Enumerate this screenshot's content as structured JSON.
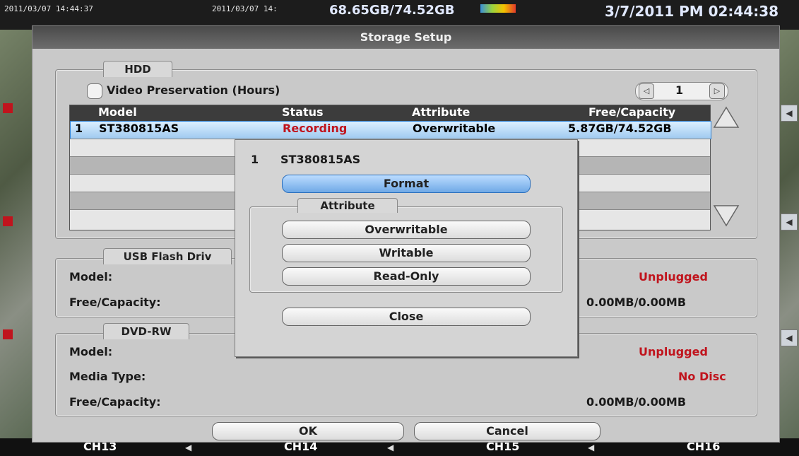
{
  "top": {
    "timestamp_left": "2011/03/07 14:44:37",
    "timestamp_mid": "2011/03/07 14:",
    "storage_usage": "68.65GB/74.52GB",
    "datetime": "3/7/2011 PM 02:44:38"
  },
  "dialog": {
    "title": "Storage Setup",
    "hdd": {
      "tab": "HDD",
      "video_preservation": "Video Preservation (Hours)",
      "page": "1",
      "columns": [
        "Model",
        "Status",
        "Attribute",
        "Free/Capacity"
      ],
      "rows": [
        {
          "index": "1",
          "model": "ST380815AS",
          "status": "Recording",
          "attribute": "Overwritable",
          "capacity": "5.87GB/74.52GB"
        }
      ]
    },
    "usb": {
      "tab": "USB Flash Driv",
      "model_label": "Model:",
      "model_value": "Unplugged",
      "capacity_label": "Free/Capacity:",
      "capacity_value": "0.00MB/0.00MB"
    },
    "dvd": {
      "tab": "DVD-RW",
      "model_label": "Model:",
      "model_value": "Unplugged",
      "media_label": "Media Type:",
      "media_value": "No Disc",
      "capacity_label": "Free/Capacity:",
      "capacity_value": "0.00MB/0.00MB"
    },
    "ok": "OK",
    "cancel": "Cancel"
  },
  "popup": {
    "index": "1",
    "model": "ST380815AS",
    "format": "Format",
    "attribute_tab": "Attribute",
    "overwritable": "Overwritable",
    "writable": "Writable",
    "read_only": "Read-Only",
    "close": "Close"
  },
  "channels": [
    "CH13",
    "CH14",
    "CH15",
    "CH16"
  ],
  "colors": {
    "status_red": "#c0141d",
    "selected_row": "#9fcaf0",
    "title_bar": "#4a4a4a"
  }
}
